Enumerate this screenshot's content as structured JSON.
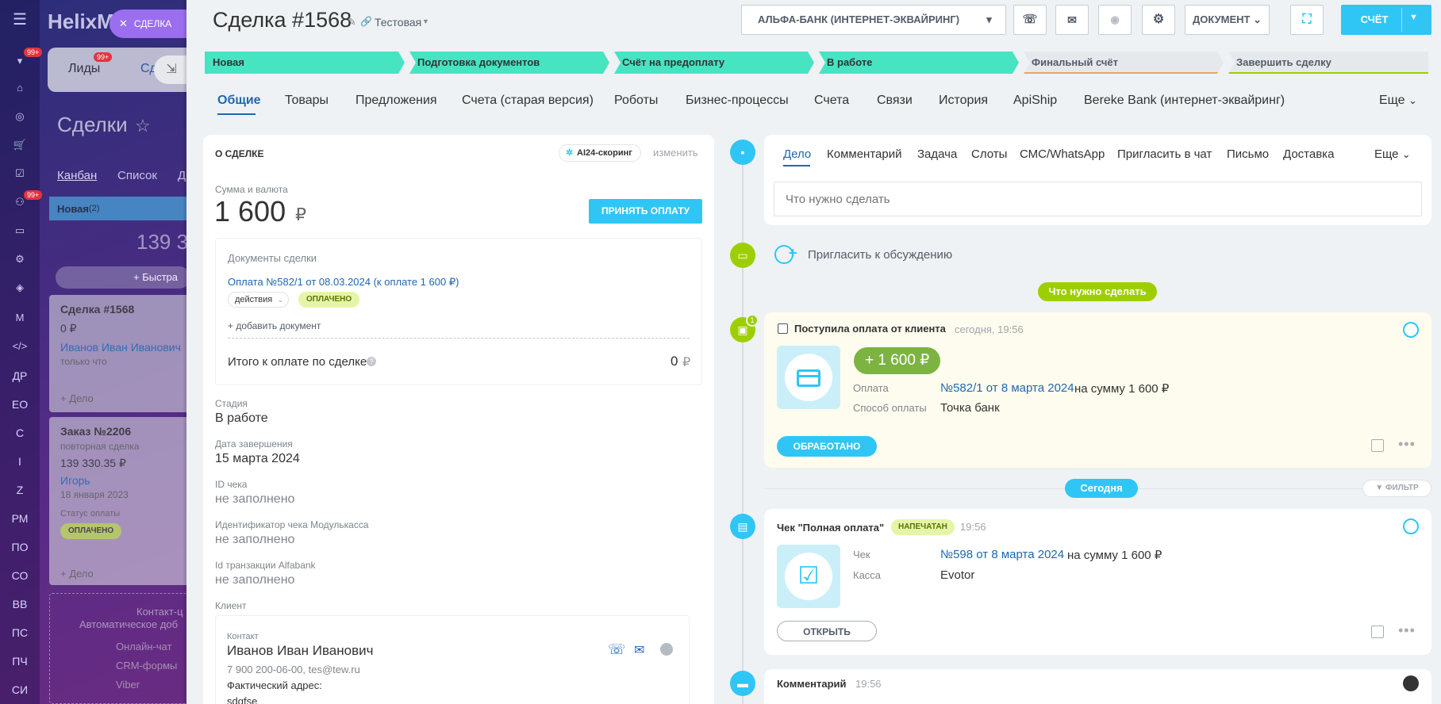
{
  "bg": {
    "logo": "HelixM",
    "tabs": [
      "Лиды",
      "Сд"
    ],
    "lids_badge": "99+",
    "page_title": "Сделки",
    "views": [
      "Канбан",
      "Список",
      "Д"
    ],
    "column_name": "Новая",
    "column_count": "(2)",
    "column_sum": "139 3",
    "quick_add": "+ Быстра",
    "nav_badge1": "99+",
    "nav_badge2": "99+",
    "nav_letters": [
      "ДР",
      "ЕО",
      "С",
      "I",
      "Z",
      "РМ",
      "ПО",
      "СО",
      "ВВ",
      "ПС",
      "ПЧ",
      "СИ"
    ],
    "card1": {
      "title": "Сделка #1568",
      "sum": "0 ₽",
      "person": "Иванов Иван Иванович",
      "time": "только что",
      "add": "+ Дело"
    },
    "card2": {
      "title": "Заказ №2206",
      "sub": "повторная сделка",
      "sum": "139 330.35 ₽",
      "person": "Игорь",
      "date": "18 января 2023",
      "status_lbl": "Статус оплаты",
      "status": "ОПЛАЧЕНО",
      "add": "+ Дело"
    },
    "contact_block": {
      "title": "Контакт-ц",
      "sub": "Автоматическое доб",
      "items": [
        "Онлайн-чат",
        "CRM-формы",
        "Viber"
      ]
    },
    "close_tab": "СДЕЛКА"
  },
  "header": {
    "title": "Сделка #1568",
    "category": "Тестовая",
    "bank_button": "АЛЬФА-БАНК (ИНТЕРНЕТ-ЭКВАЙРИНГ)",
    "document_button": "ДОКУМЕНТ",
    "invoice_button": "СЧЁТ"
  },
  "stages": [
    {
      "label": "Новая",
      "color": "#47e4c2"
    },
    {
      "label": "Подготовка документов",
      "color": "#47e4c2"
    },
    {
      "label": "Счёт на предоплату",
      "color": "#47e4c2"
    },
    {
      "label": "В работе",
      "color": "#47e4c2"
    },
    {
      "label": "Финальный счёт",
      "color": "#e6e9ec"
    },
    {
      "label": "Завершить сделку",
      "color": "#e6e9ec"
    }
  ],
  "tabs": [
    "Общие",
    "Товары",
    "Предложения",
    "Счета (старая версия)",
    "Роботы",
    "Бизнес-процессы",
    "Счета",
    "Связи",
    "История",
    "ApiShip",
    "Bereke Bank (интернет-эквайринг)"
  ],
  "tabs_more": "Еще",
  "about": {
    "section_title": "О СДЕЛКЕ",
    "ai_badge": "AI24-скоринг",
    "change": "изменить",
    "sum_label": "Сумма и валюта",
    "sum_value": "1 600",
    "currency": "₽",
    "accept_payment": "ПРИНЯТЬ ОПЛАТУ",
    "docs_title": "Документы сделки",
    "doc_link": "Оплата №582/1 от 08.03.2024 (к оплате 1 600 ₽)",
    "doc_actions": "действия",
    "doc_status": "оплачено",
    "add_doc": "+ добавить документ",
    "total_label": "Итого к оплате по сделке",
    "total_value": "0",
    "total_currency": "₽",
    "stage_label": "Стадия",
    "stage_value": "В работе",
    "close_date_label": "Дата завершения",
    "close_date_value": "15 марта 2024",
    "check_id_label": "ID чека",
    "check_id_value": "не заполнено",
    "modulkassa_label": "Идентификатор чека Модулькасса",
    "modulkassa_value": "не заполнено",
    "alfa_label": "Id транзакции Alfabank",
    "alfa_value": "не заполнено",
    "client_label": "Клиент",
    "contact_label": "Контакт",
    "contact_name": "Иванов Иван Иванович",
    "contact_info": "7 900 200-06-00, tes@tew.ru",
    "address_label": "Фактический адрес:",
    "address_value": "sdgfse"
  },
  "timeline": {
    "tabs": [
      "Дело",
      "Комментарий",
      "Задача",
      "Слоты",
      "СМС/WhatsApp",
      "Пригласить в чат",
      "Письмо",
      "Доставка"
    ],
    "tabs_more": "Еще",
    "input_placeholder": "Что нужно сделать",
    "invite": "Пригласить к обсуждению",
    "todo_pill": "Что нужно сделать",
    "payment": {
      "badge": "1",
      "title": "Поступила оплата от клиента",
      "time": "сегодня, 19:56",
      "amount": "+ 1 600 ₽",
      "pay_label": "Оплата",
      "pay_link": "№582/1 от 8 марта 2024",
      "pay_suffix": "на сумму 1 600 ₽",
      "method_label": "Способ оплаты",
      "method_value": "Точка банк",
      "processed": "ОБРАБОТАНО"
    },
    "today_pill": "Сегодня",
    "filter": "ФИЛЬТР",
    "receipt": {
      "title": "Чек \"Полная оплата\"",
      "badge": "НАПЕЧАТАН",
      "time": "19:56",
      "check_label": "Чек",
      "check_link": "№598 от 8 марта 2024",
      "check_suffix": "на сумму 1 600 ₽",
      "kassa_label": "Касса",
      "kassa_value": "Evotor",
      "open": "ОТКРЫТЬ"
    },
    "comment": {
      "title": "Комментарий",
      "time": "19:56"
    }
  },
  "colors": {
    "accent": "#2fc6f6",
    "green": "#47e4c2",
    "lime": "#9dcf00",
    "link": "#2067b0"
  }
}
